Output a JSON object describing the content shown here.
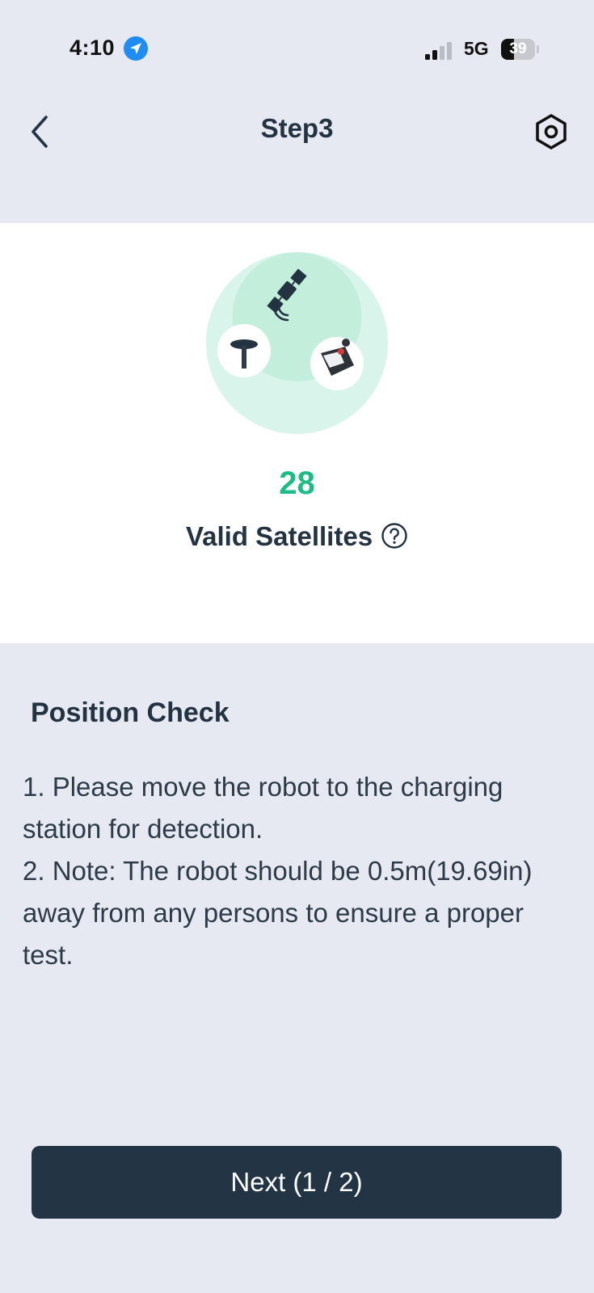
{
  "status_bar": {
    "time": "4:10",
    "location_icon": "location-arrow-icon",
    "signal_icon": "cellular-signal-icon",
    "network": "5G",
    "battery_level": "39",
    "battery_fraction": 0.39
  },
  "nav": {
    "back_icon": "chevron-left-icon",
    "title": "Step3",
    "settings_icon": "hexagon-settings-icon"
  },
  "satellite": {
    "illustration_icons": [
      "satellite-icon",
      "antenna-icon",
      "robot-mower-icon"
    ],
    "count": "28",
    "label": "Valid Satellites",
    "help_icon": "question-circle-icon"
  },
  "position_check": {
    "title": "Position Check",
    "instructions": [
      "1. Please move the robot to the charging station for detection.",
      "2. Note: The robot should be 0.5m(19.69in) away from any persons to ensure a proper test."
    ]
  },
  "footer": {
    "next_label": "Next (1 / 2)"
  },
  "colors": {
    "accent_green": "#1ebc84",
    "primary_dark": "#233445",
    "background": "#e6e9f1",
    "location_blue": "#1e8cf0",
    "illustration_light": "#d9f5eb",
    "illustration_mid": "#c3eedc"
  }
}
